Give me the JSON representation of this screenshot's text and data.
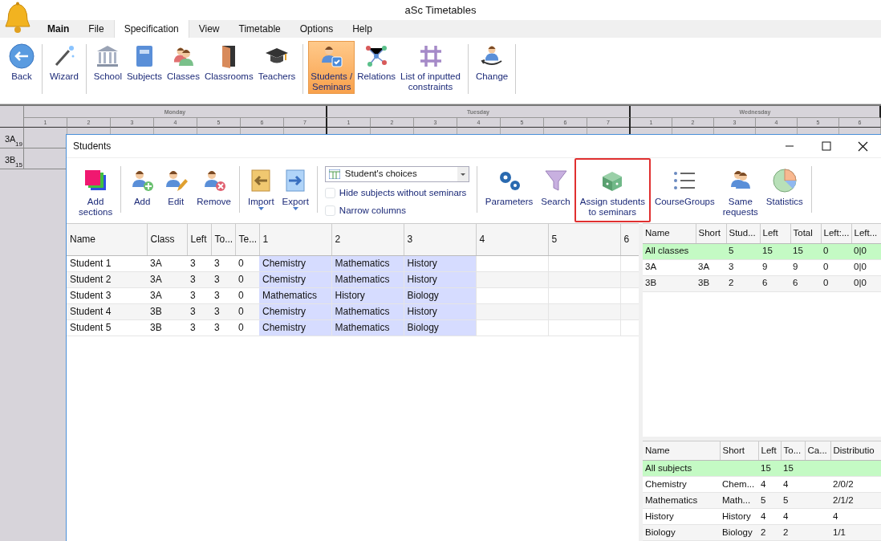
{
  "app": {
    "title": "aSc Timetables"
  },
  "menu_tabs": [
    {
      "label": "Main",
      "bold": true,
      "selected": false
    },
    {
      "label": "File",
      "bold": false,
      "selected": false
    },
    {
      "label": "Specification",
      "bold": false,
      "selected": true
    },
    {
      "label": "View",
      "bold": false,
      "selected": false
    },
    {
      "label": "Timetable",
      "bold": false,
      "selected": false
    },
    {
      "label": "Options",
      "bold": false,
      "selected": false
    },
    {
      "label": "Help",
      "bold": false,
      "selected": false
    }
  ],
  "ribbon_groups": [
    [
      {
        "label": "Back",
        "selected": false
      }
    ],
    [
      {
        "label": "Wizard",
        "selected": false
      }
    ],
    [
      {
        "label": "School",
        "selected": false
      },
      {
        "label": "Subjects",
        "selected": false
      },
      {
        "label": "Classes",
        "selected": false
      },
      {
        "label": "Classrooms",
        "selected": false
      },
      {
        "label": "Teachers",
        "selected": false
      }
    ],
    [
      {
        "label": "Students /\nSeminars",
        "selected": true
      },
      {
        "label": "Relations",
        "selected": false
      },
      {
        "label": "List of inputted\nconstraints",
        "selected": false
      }
    ],
    [
      {
        "label": "Change",
        "selected": false
      }
    ]
  ],
  "timetable": {
    "days": [
      {
        "name": "Monday",
        "periods": [
          "1",
          "2",
          "3",
          "4",
          "5",
          "6",
          "7"
        ]
      },
      {
        "name": "Tuesday",
        "periods": [
          "1",
          "2",
          "3",
          "4",
          "5",
          "6",
          "7"
        ]
      },
      {
        "name": "Wednesday",
        "periods": [
          "1",
          "2",
          "3",
          "4",
          "5",
          "6"
        ]
      }
    ],
    "rows": [
      {
        "class": "3A",
        "count": "19"
      },
      {
        "class": "3B",
        "count": "15"
      }
    ]
  },
  "dialog": {
    "title": "Students",
    "toolbar_groups": [
      [
        {
          "label": "Add\nsections",
          "dropdown": false,
          "highlighted": false
        }
      ],
      [
        {
          "label": "Add",
          "dropdown": false,
          "highlighted": false
        },
        {
          "label": "Edit",
          "dropdown": false,
          "highlighted": false
        },
        {
          "label": "Remove",
          "dropdown": false,
          "highlighted": false
        }
      ],
      [
        {
          "label": "Import",
          "dropdown": true,
          "highlighted": false
        },
        {
          "label": "Export",
          "dropdown": true,
          "highlighted": false
        }
      ]
    ],
    "view_select": {
      "value": "Student's choices"
    },
    "options": [
      {
        "label": "Hide subjects without seminars",
        "checked": false
      },
      {
        "label": "Narrow columns",
        "checked": false
      }
    ],
    "toolbar_groups_2": [
      [
        {
          "label": "Parameters",
          "dropdown": false,
          "highlighted": false
        },
        {
          "label": "Search",
          "dropdown": false,
          "highlighted": false
        },
        {
          "label": "Assign students\nto seminars",
          "dropdown": false,
          "highlighted": true
        },
        {
          "label": "CourseGroups",
          "dropdown": false,
          "highlighted": false
        },
        {
          "label": "Same\nrequests",
          "dropdown": false,
          "highlighted": false
        },
        {
          "label": "Statistics",
          "dropdown": false,
          "highlighted": false
        }
      ]
    ],
    "students_table": {
      "columns": [
        {
          "label": "Name",
          "kind": "text"
        },
        {
          "label": "Class",
          "kind": "text"
        },
        {
          "label": "Left",
          "kind": "text"
        },
        {
          "label": "To...",
          "kind": "text"
        },
        {
          "label": "Te...",
          "kind": "text"
        },
        {
          "label": "1",
          "kind": "slot"
        },
        {
          "label": "2",
          "kind": "slot"
        },
        {
          "label": "3",
          "kind": "slot"
        },
        {
          "label": "4",
          "kind": "slot"
        },
        {
          "label": "5",
          "kind": "slot"
        },
        {
          "label": "6",
          "kind": "slot"
        }
      ],
      "rows": [
        [
          "Student 1",
          "3A",
          "3",
          "3",
          "0",
          "Chemistry",
          "Mathematics",
          "History",
          "",
          "",
          ""
        ],
        [
          "Student 2",
          "3A",
          "3",
          "3",
          "0",
          "Chemistry",
          "Mathematics",
          "History",
          "",
          "",
          ""
        ],
        [
          "Student 3",
          "3A",
          "3",
          "3",
          "0",
          "Mathematics",
          "History",
          "Biology",
          "",
          "",
          ""
        ],
        [
          "Student 4",
          "3B",
          "3",
          "3",
          "0",
          "Chemistry",
          "Mathematics",
          "History",
          "",
          "",
          ""
        ],
        [
          "Student 5",
          "3B",
          "3",
          "3",
          "0",
          "Chemistry",
          "Mathematics",
          "Biology",
          "",
          "",
          ""
        ]
      ]
    },
    "classes_table": {
      "columns": [
        "Name",
        "Short",
        "Stud...",
        "Left",
        "Total",
        "Left:...",
        "Left..."
      ],
      "rows": [
        {
          "kind": "summary",
          "cells": [
            "All classes",
            "",
            "5",
            "15",
            "15",
            "0",
            "0|0"
          ]
        },
        {
          "kind": "item",
          "cells": [
            "3A",
            "3A",
            "3",
            "9",
            "9",
            "0",
            "0|0"
          ]
        },
        {
          "kind": "item",
          "cells": [
            "3B",
            "3B",
            "2",
            "6",
            "6",
            "0",
            "0|0"
          ]
        }
      ]
    },
    "subjects_table": {
      "columns": [
        "Name",
        "Short",
        "Left",
        "To...",
        "Ca...",
        "Distributio"
      ],
      "rows": [
        {
          "kind": "summary",
          "cells": [
            "All subjects",
            "",
            "15",
            "15",
            "",
            ""
          ]
        },
        {
          "kind": "item",
          "cells": [
            "Chemistry",
            "Chem...",
            "4",
            "4",
            "",
            "2/0/2"
          ]
        },
        {
          "kind": "item",
          "cells": [
            "Mathematics",
            "Math...",
            "5",
            "5",
            "",
            "2/1/2"
          ]
        },
        {
          "kind": "item",
          "cells": [
            "History",
            "History",
            "4",
            "4",
            "",
            "4"
          ]
        },
        {
          "kind": "item",
          "cells": [
            "Biology",
            "Biology",
            "2",
            "2",
            "",
            "1/1"
          ]
        }
      ]
    }
  }
}
